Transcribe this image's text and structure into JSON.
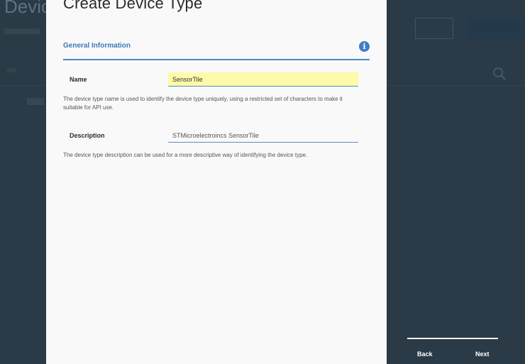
{
  "background": {
    "page_title": "Device"
  },
  "modal": {
    "title": "Create Device Type",
    "section": {
      "title": "General Information",
      "info_icon": "info-icon"
    },
    "fields": {
      "name": {
        "label": "Name",
        "value": "SensorTile",
        "help": "The device type name is used to identify the device type uniquely, using a restricted set of characters to make it suitable for API use."
      },
      "description": {
        "label": "Description",
        "value": "STMicroelectroincs SensorTile",
        "help": "The device type description can be used for a more descriptive way of identifying the device type."
      }
    }
  },
  "navigation": {
    "back_label": "Back",
    "next_label": "Next"
  },
  "colors": {
    "background": "#2a3a46",
    "modal": "#f9f9f9",
    "accent": "#3d79b8",
    "name_field_highlight": "#fdfaa9"
  }
}
